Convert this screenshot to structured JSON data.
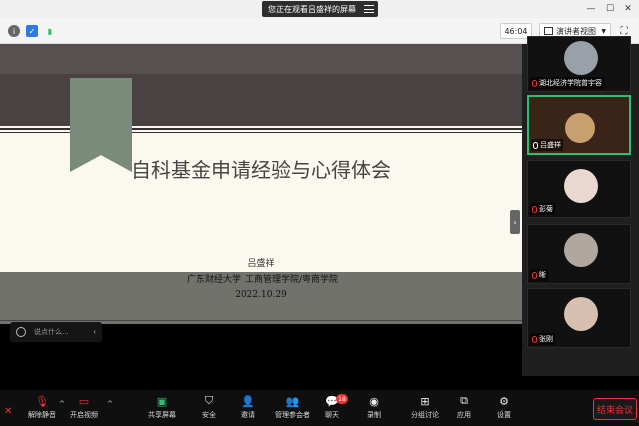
{
  "window": {
    "share_banner": "您正在观看吕盛祥的屏幕"
  },
  "topbar": {
    "timer": "46:04",
    "view_button": "演讲者视图"
  },
  "slide": {
    "title": "自科基金申请经验与心得体会",
    "presenter": "吕盛祥",
    "affiliation_left": "广东财经大学",
    "affiliation_right": "工商管理学院/粤商学院",
    "date": "2022.10.29"
  },
  "chat": {
    "placeholder": "说点什么..."
  },
  "participants": [
    {
      "name": "湖北经济学院曾宇容",
      "avatar_color": "#9aa0a8"
    },
    {
      "name": "吕盛祥",
      "avatar_color": "#c8a070"
    },
    {
      "name": "彭菊",
      "avatar_color": "#e8d8d0"
    },
    {
      "name": "晰",
      "avatar_color": "#b0a8a0"
    },
    {
      "name": "张刚",
      "avatar_color": "#d8c0b0"
    }
  ],
  "toolbar": {
    "mute_label": "解除静音",
    "video_label": "开启视频",
    "share_label": "共享屏幕",
    "security_label": "安全",
    "invite_label": "邀请",
    "members_label": "管理参会者",
    "chat_label": "聊天",
    "chat_badge": "18",
    "record_label": "录制",
    "breakout_label": "分组讨论",
    "apps_label": "应用",
    "settings_label": "设置",
    "end_label": "结束会议"
  },
  "colors": {
    "accent_green": "#2dbf6f",
    "end_red": "#e33333"
  }
}
